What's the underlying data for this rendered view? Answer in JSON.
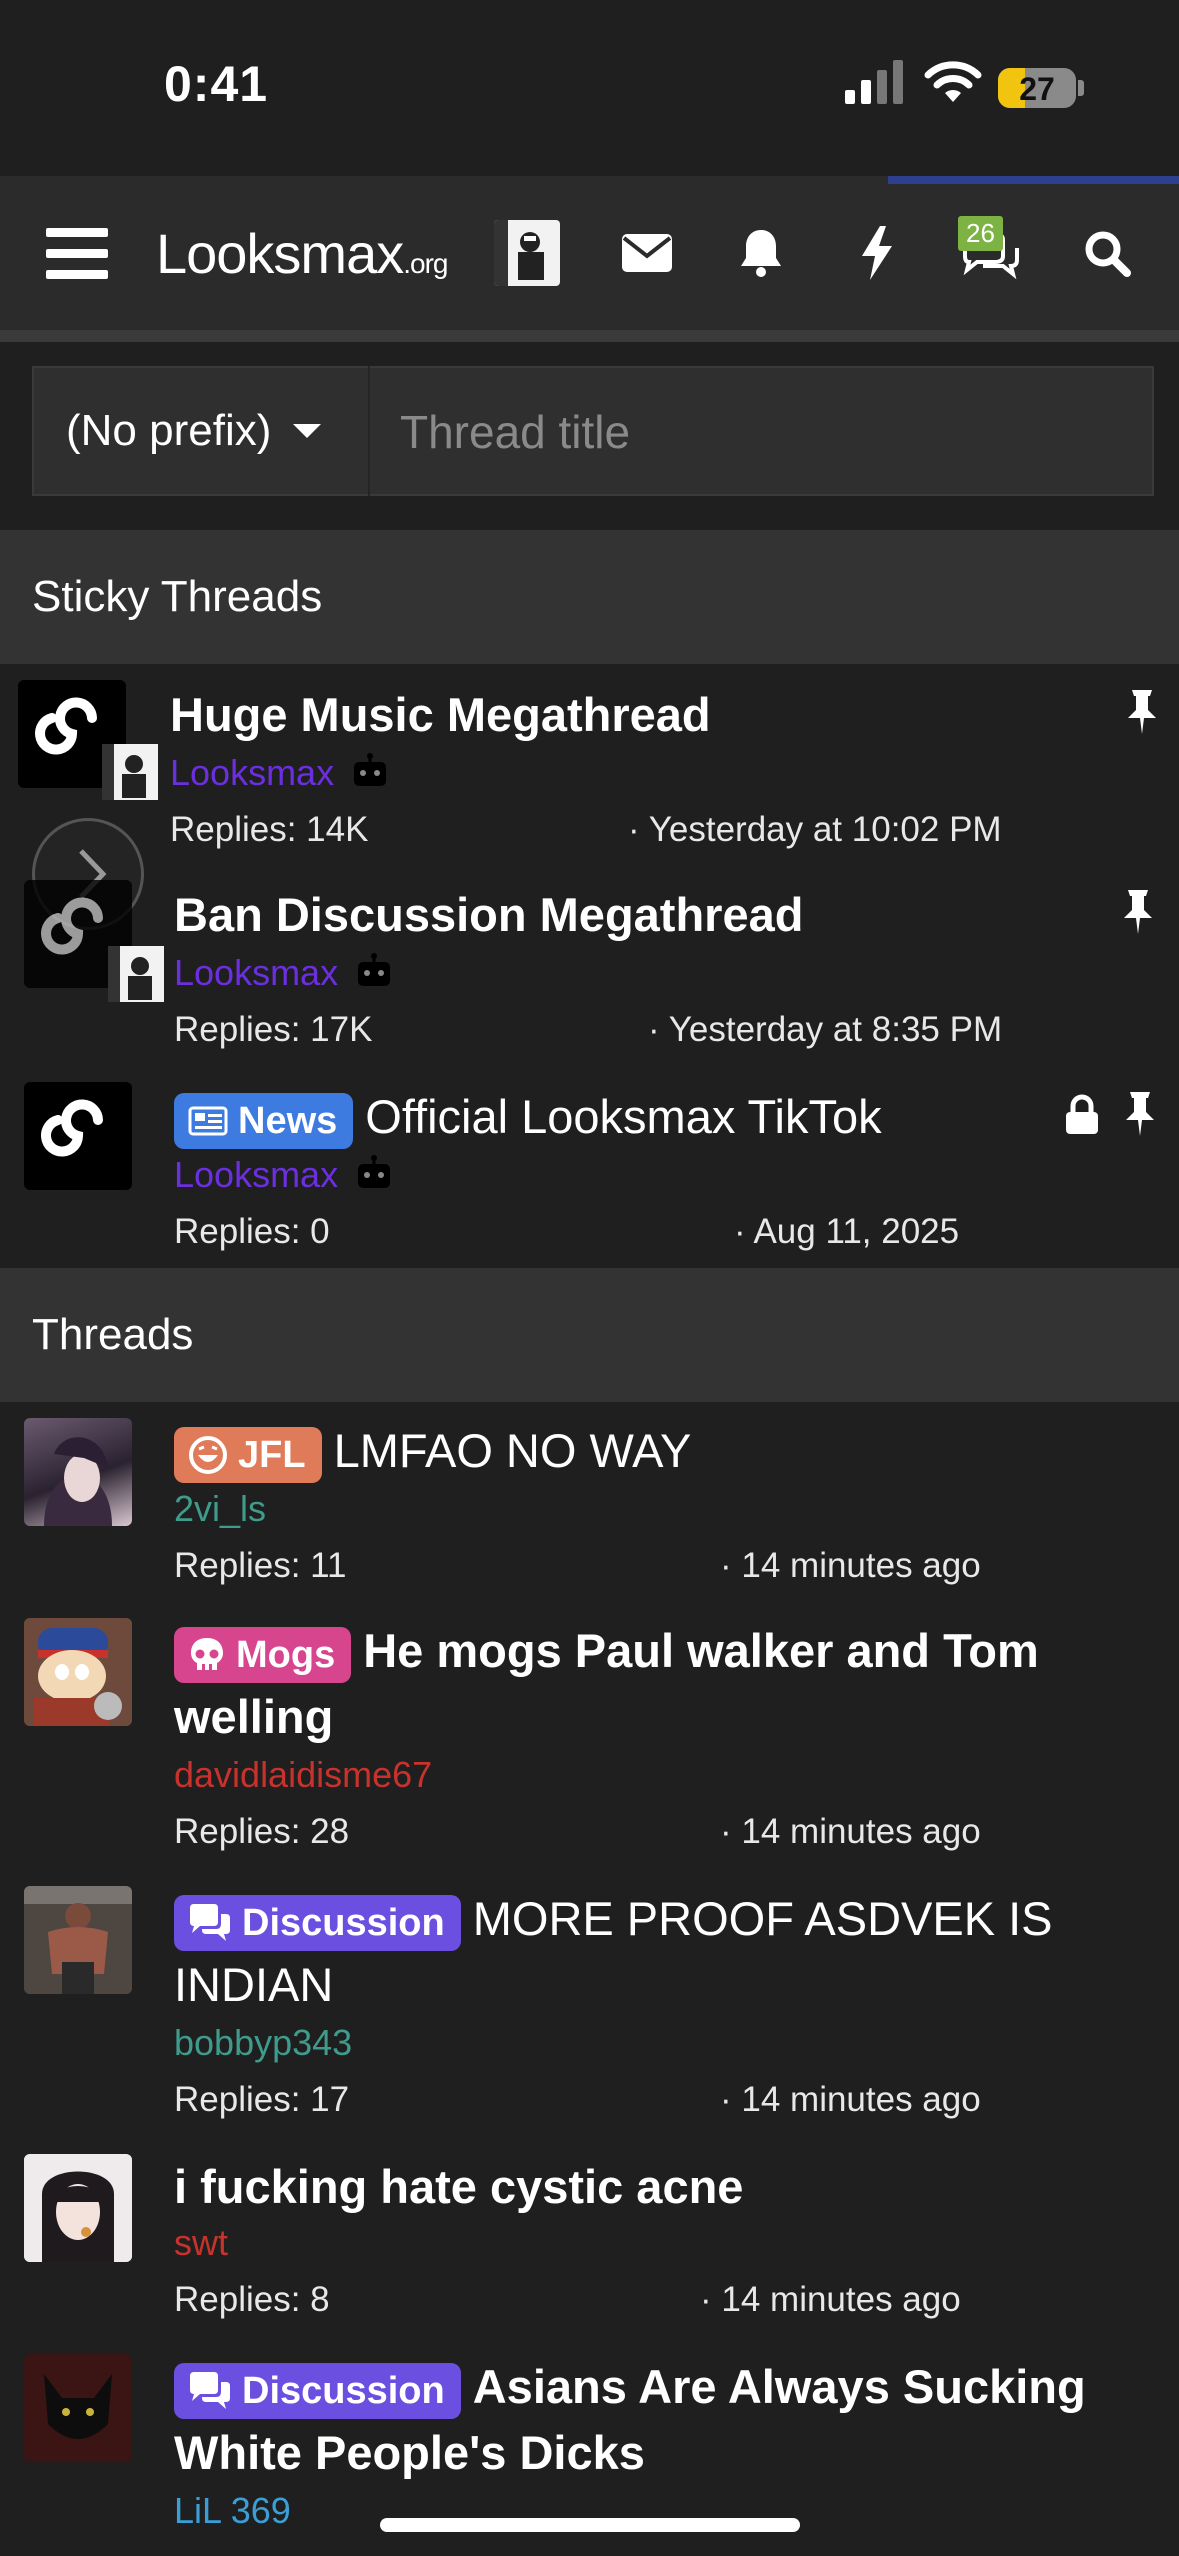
{
  "status_bar": {
    "time": "0:41",
    "battery": "27"
  },
  "nav": {
    "logo": "Looksmax",
    "logo_suffix": ".org",
    "alerts_badge": "26"
  },
  "filter": {
    "prefix_label": "(No prefix)",
    "title_placeholder": "Thread title"
  },
  "sections": {
    "sticky": "Sticky Threads",
    "threads": "Threads"
  },
  "sticky_threads": [
    {
      "title": "Huge Music Megathread",
      "author": "Looksmax",
      "replies": "Replies: 14K",
      "date": "· Yesterday at 10:02 PM"
    },
    {
      "title": "Ban Discussion Megathread",
      "author": "Looksmax",
      "replies": "Replies: 17K",
      "date": "· Yesterday at 8:35 PM"
    },
    {
      "prefix": "News",
      "title": "Official Looksmax TikTok",
      "author": "Looksmax",
      "replies": "Replies: 0",
      "date": "· Aug 11, 2025"
    }
  ],
  "threads": [
    {
      "prefix": "JFL",
      "title": "LMFAO NO WAY",
      "author": "2vi_ls",
      "replies": "Replies: 11",
      "date": "· 14 minutes ago"
    },
    {
      "prefix": "Mogs",
      "title": "He mogs Paul walker and Tom welling",
      "author": "davidlaidisme67",
      "replies": "Replies: 28",
      "date": "· 14 minutes ago"
    },
    {
      "prefix": "Discussion",
      "title": "MORE PROOF ASDVEK IS INDIAN",
      "author": "bobbyp343",
      "replies": "Replies: 17",
      "date": "· 14 minutes ago"
    },
    {
      "title": "i fucking hate cystic acne",
      "author": "swt",
      "replies": "Replies: 8",
      "date": "· 14 minutes ago"
    },
    {
      "prefix": "Discussion",
      "title": "Asians Are Always Sucking White People's Dicks",
      "author": "LiL 369"
    }
  ],
  "colors": {
    "background": "#1f1f1f",
    "news": "#3d7be0",
    "jfl": "#e07b5a",
    "mogs": "#d8458f",
    "discussion": "#6b4fe0",
    "staff_author": "#6b2fe0",
    "teal_author": "#3f9b8c",
    "red_author": "#c8322c",
    "blue_author": "#3a9fd6"
  }
}
